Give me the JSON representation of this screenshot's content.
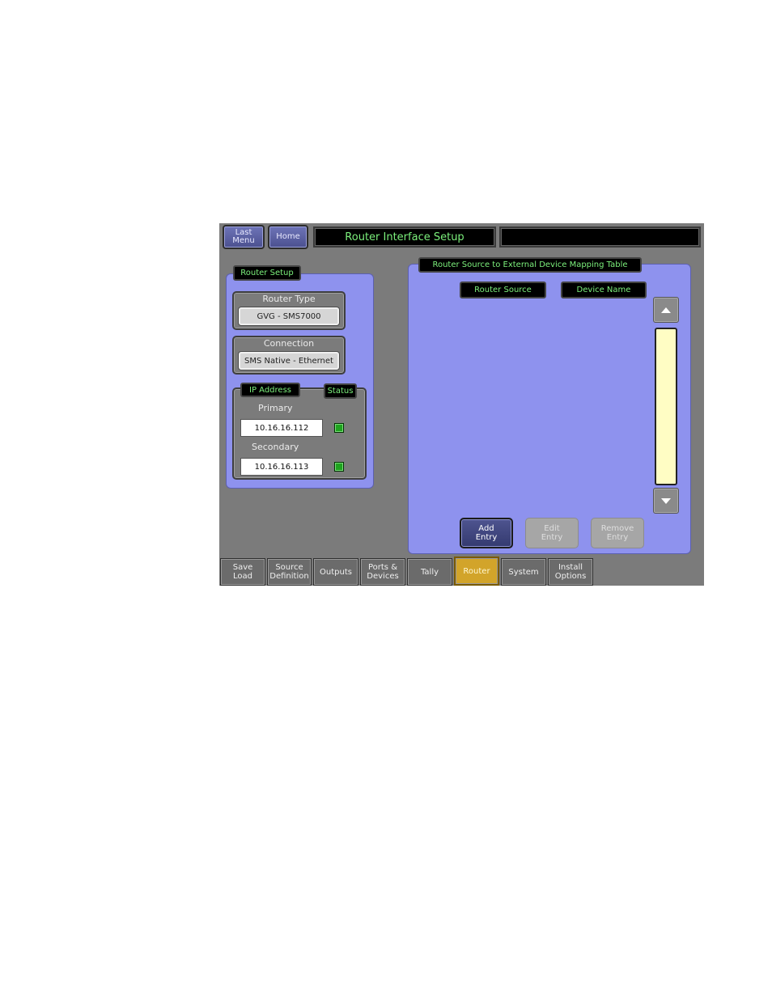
{
  "topbar": {
    "last_menu": "Last\nMenu",
    "home": "Home",
    "title": "Router Interface Setup",
    "secondary_title": ""
  },
  "router_setup": {
    "header": "Router Setup",
    "router_type_label": "Router Type",
    "router_type_value": "GVG - SMS7000",
    "connection_label": "Connection",
    "connection_value": "SMS Native - Ethernet",
    "ip_address_label": "IP Address",
    "status_label": "Status",
    "primary_label": "Primary",
    "primary_ip": "10.16.16.112",
    "secondary_label": "Secondary",
    "secondary_ip": "10.16.16.113"
  },
  "mapping_table": {
    "header": "Router Source to External Device Mapping Table",
    "columns": [
      "Router Source",
      "Device Name"
    ],
    "rows": []
  },
  "actions": {
    "add": "Add\nEntry",
    "edit": "Edit\nEntry",
    "remove": "Remove\nEntry"
  },
  "tabs": [
    {
      "label": "Save\nLoad",
      "active": false
    },
    {
      "label": "Source\nDefinition",
      "active": false
    },
    {
      "label": "Outputs",
      "active": false
    },
    {
      "label": "Ports &\nDevices",
      "active": false
    },
    {
      "label": "Tally",
      "active": false
    },
    {
      "label": "Router",
      "active": true
    },
    {
      "label": "System",
      "active": false
    },
    {
      "label": "Install\nOptions",
      "active": false
    }
  ],
  "colors": {
    "panel": "#8e92ee",
    "title_text": "#7cf07c",
    "active_tab": "#d2a42a",
    "status_ok": "#1fa31f",
    "scroll_track": "#fffdc4"
  }
}
